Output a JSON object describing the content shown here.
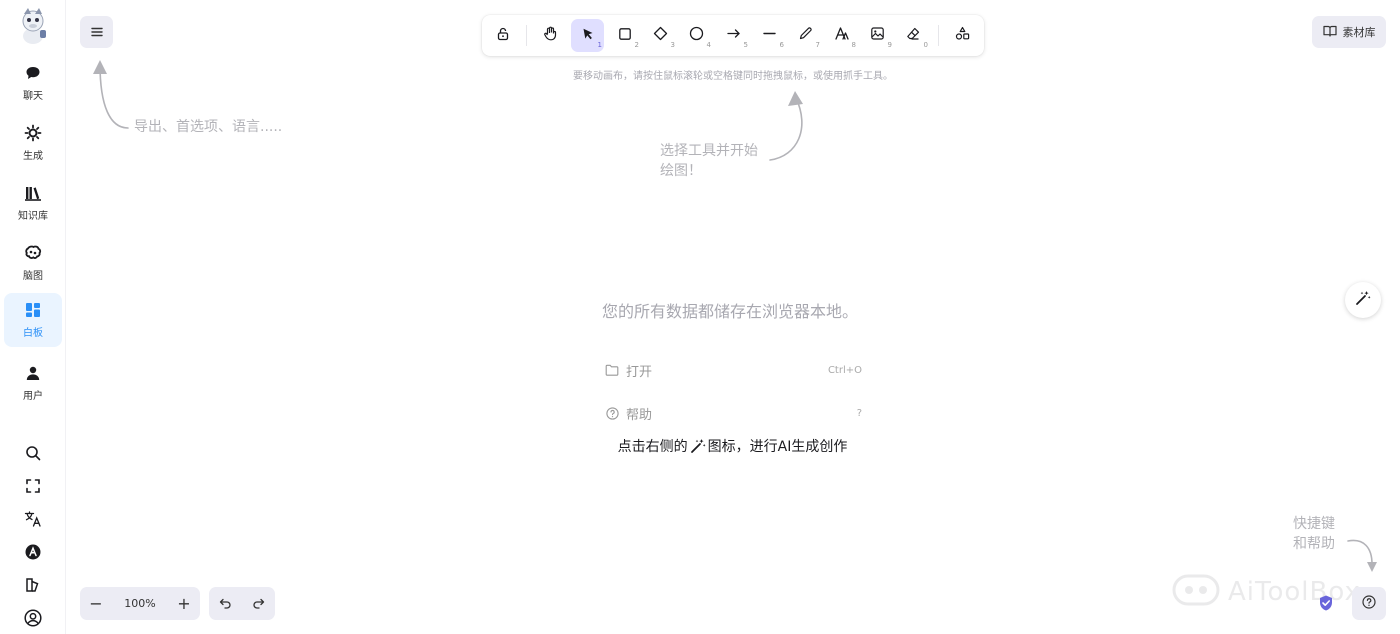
{
  "sidebar": {
    "items": [
      {
        "label": "聊天",
        "icon": "chat-icon"
      },
      {
        "label": "生成",
        "icon": "sparkle-gear-icon"
      },
      {
        "label": "知识库",
        "icon": "library-icon"
      },
      {
        "label": "脑图",
        "icon": "brain-icon"
      },
      {
        "label": "白板",
        "icon": "whiteboard-icon",
        "active": true
      },
      {
        "label": "用户",
        "icon": "user-icon"
      }
    ],
    "tools": [
      "search-icon",
      "fullscreen-icon",
      "translate-icon",
      "openai-icon",
      "sidepanel-icon",
      "account-circle-icon"
    ]
  },
  "toolbar": {
    "tools": [
      {
        "name": "lock",
        "key": ""
      },
      {
        "name": "hand",
        "key": ""
      },
      {
        "name": "selection",
        "key": "1",
        "active": true
      },
      {
        "name": "rectangle",
        "key": "2"
      },
      {
        "name": "diamond",
        "key": "3"
      },
      {
        "name": "ellipse",
        "key": "4"
      },
      {
        "name": "arrow",
        "key": "5"
      },
      {
        "name": "line",
        "key": "6"
      },
      {
        "name": "draw",
        "key": "7"
      },
      {
        "name": "text",
        "key": "8"
      },
      {
        "name": "image",
        "key": "9"
      },
      {
        "name": "eraser",
        "key": "0"
      },
      {
        "name": "more",
        "key": ""
      }
    ],
    "hint": "要移动画布，请按住鼠标滚轮或空格键同时拖拽鼠标，或使用抓手工具。"
  },
  "library": {
    "label": "素材库"
  },
  "hints": {
    "menu": "导出、首选项、语言.....",
    "toolbar_line1": "选择工具并开始",
    "toolbar_line2": "绘图！",
    "shortcuts_line1": "快捷键",
    "shortcuts_line2": "和帮助"
  },
  "welcome": {
    "title": "您的所有数据都储存在浏览器本地。",
    "open_label": "打开",
    "open_shortcut": "Ctrl+O",
    "help_label": "帮助",
    "help_shortcut": "?",
    "ai_hint_before": "点击右侧的",
    "ai_hint_after": "图标，进行AI生成创作"
  },
  "zoom": {
    "value": "100%",
    "minus": "−",
    "plus": "+"
  },
  "watermark": {
    "text": "AiToolBox"
  },
  "colors": {
    "accent": "#6965db",
    "active_nav": "#2a8ff7",
    "active_tool_bg": "#e0dfff"
  }
}
